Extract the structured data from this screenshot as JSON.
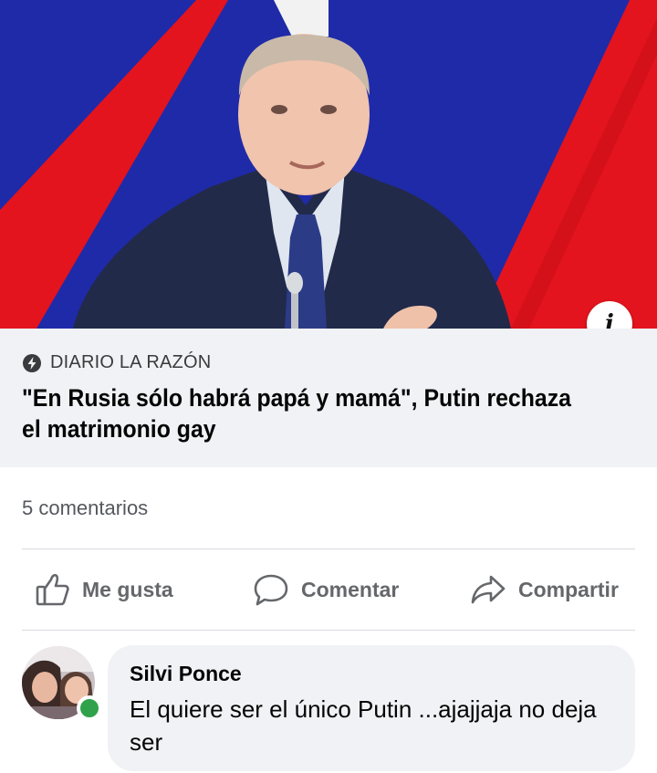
{
  "hero": {
    "image_description": "Photo of Vladimir Putin speaking at a microphone in front of a Russian flag",
    "info_button_glyph": "i"
  },
  "link_preview": {
    "source_icon": "bolt-icon",
    "source": "DIARIO LA RAZÓN",
    "headline": "\"En Rusia sólo habrá papá y mamá\", Putin rechaza el matrimonio gay"
  },
  "post_meta": {
    "comments_count": "5 comentarios"
  },
  "actions": [
    {
      "icon": "thumbs-up-icon",
      "label": "Me gusta"
    },
    {
      "icon": "comment-icon",
      "label": "Comentar"
    },
    {
      "icon": "share-icon",
      "label": "Compartir"
    }
  ],
  "comment": {
    "author": "Silvi Ponce",
    "text": "El quiere ser el único Putin ...ajajjaja no deja ser",
    "online": true
  },
  "colors": {
    "flag_blue": "#1f2aa8",
    "flag_red": "#e3141d",
    "flag_white": "#f2f2f2",
    "action_gray": "#65676b",
    "online_green": "#31a24c",
    "preview_bg": "#f0f2f5"
  }
}
